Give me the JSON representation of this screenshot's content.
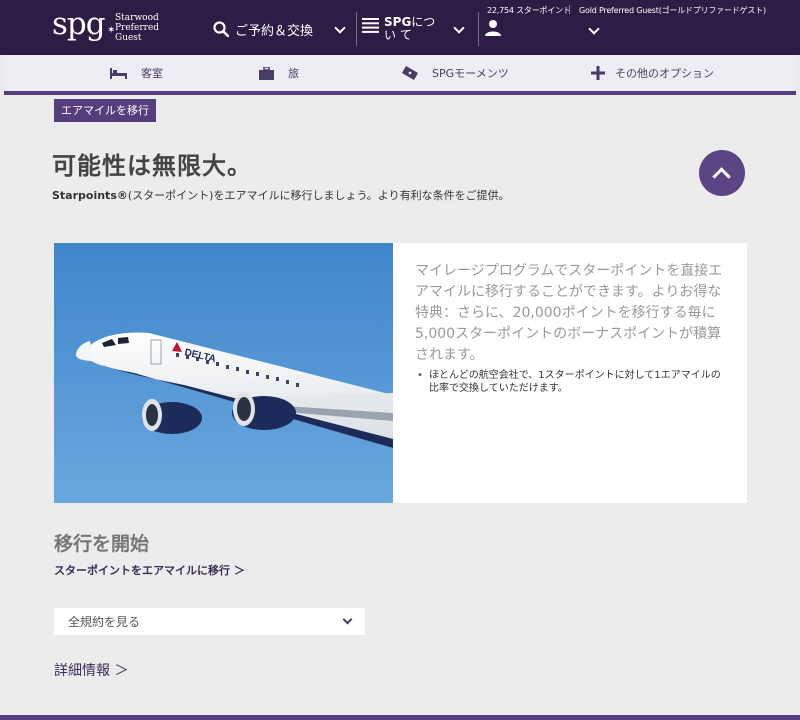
{
  "header": {
    "logo_spg": "spg",
    "logo_line1": "Starwood",
    "logo_line2": "Preferred",
    "logo_line3": "Guest",
    "reserve_label": "ご予約＆交換",
    "about_label_bold": "SPG",
    "about_label_rest": "につい て",
    "points": "22,754 スターポイント",
    "status": "Gold Preferred Guest(ゴールドプリファードゲスト)"
  },
  "subnav": {
    "items": [
      {
        "label": "客室",
        "icon": "bed-icon"
      },
      {
        "label": "旅",
        "icon": "suitcase-icon",
        "active": true
      },
      {
        "label": "SPGモーメンツ",
        "icon": "ticket-icon"
      },
      {
        "label": "その他のオプション",
        "icon": "plus-icon"
      }
    ]
  },
  "content": {
    "tag": "エアマイルを移行",
    "headline": "可能性は無限大。",
    "subhead_bold": "Starpoints®",
    "subhead_rest": "(スターポイント)をエアマイルに移行しましょう。より有利な条件をご提供。",
    "promo_text": "マイレージプログラムでスターポイントを直接エアマイルに移行することができます。よりお得な特典：さらに、20,000ポイントを移行する毎に5,000スターポイントのボーナスポイントが積算されます。",
    "promo_bullet": "ほとんどの航空会社で、1スターポイントに対して1エアマイルの比率で交換していただけます。",
    "plane_brand": "DELTA",
    "section_title": "移行を開始",
    "transfer_link": "スターポイントをエアマイルに移行 ＞",
    "terms_label": "全規約を見る",
    "details_link": "詳細情報 ＞"
  },
  "colors": {
    "header_bg": "#2d1c44",
    "accent": "#563d7c",
    "sky": "#4a8fd0"
  }
}
